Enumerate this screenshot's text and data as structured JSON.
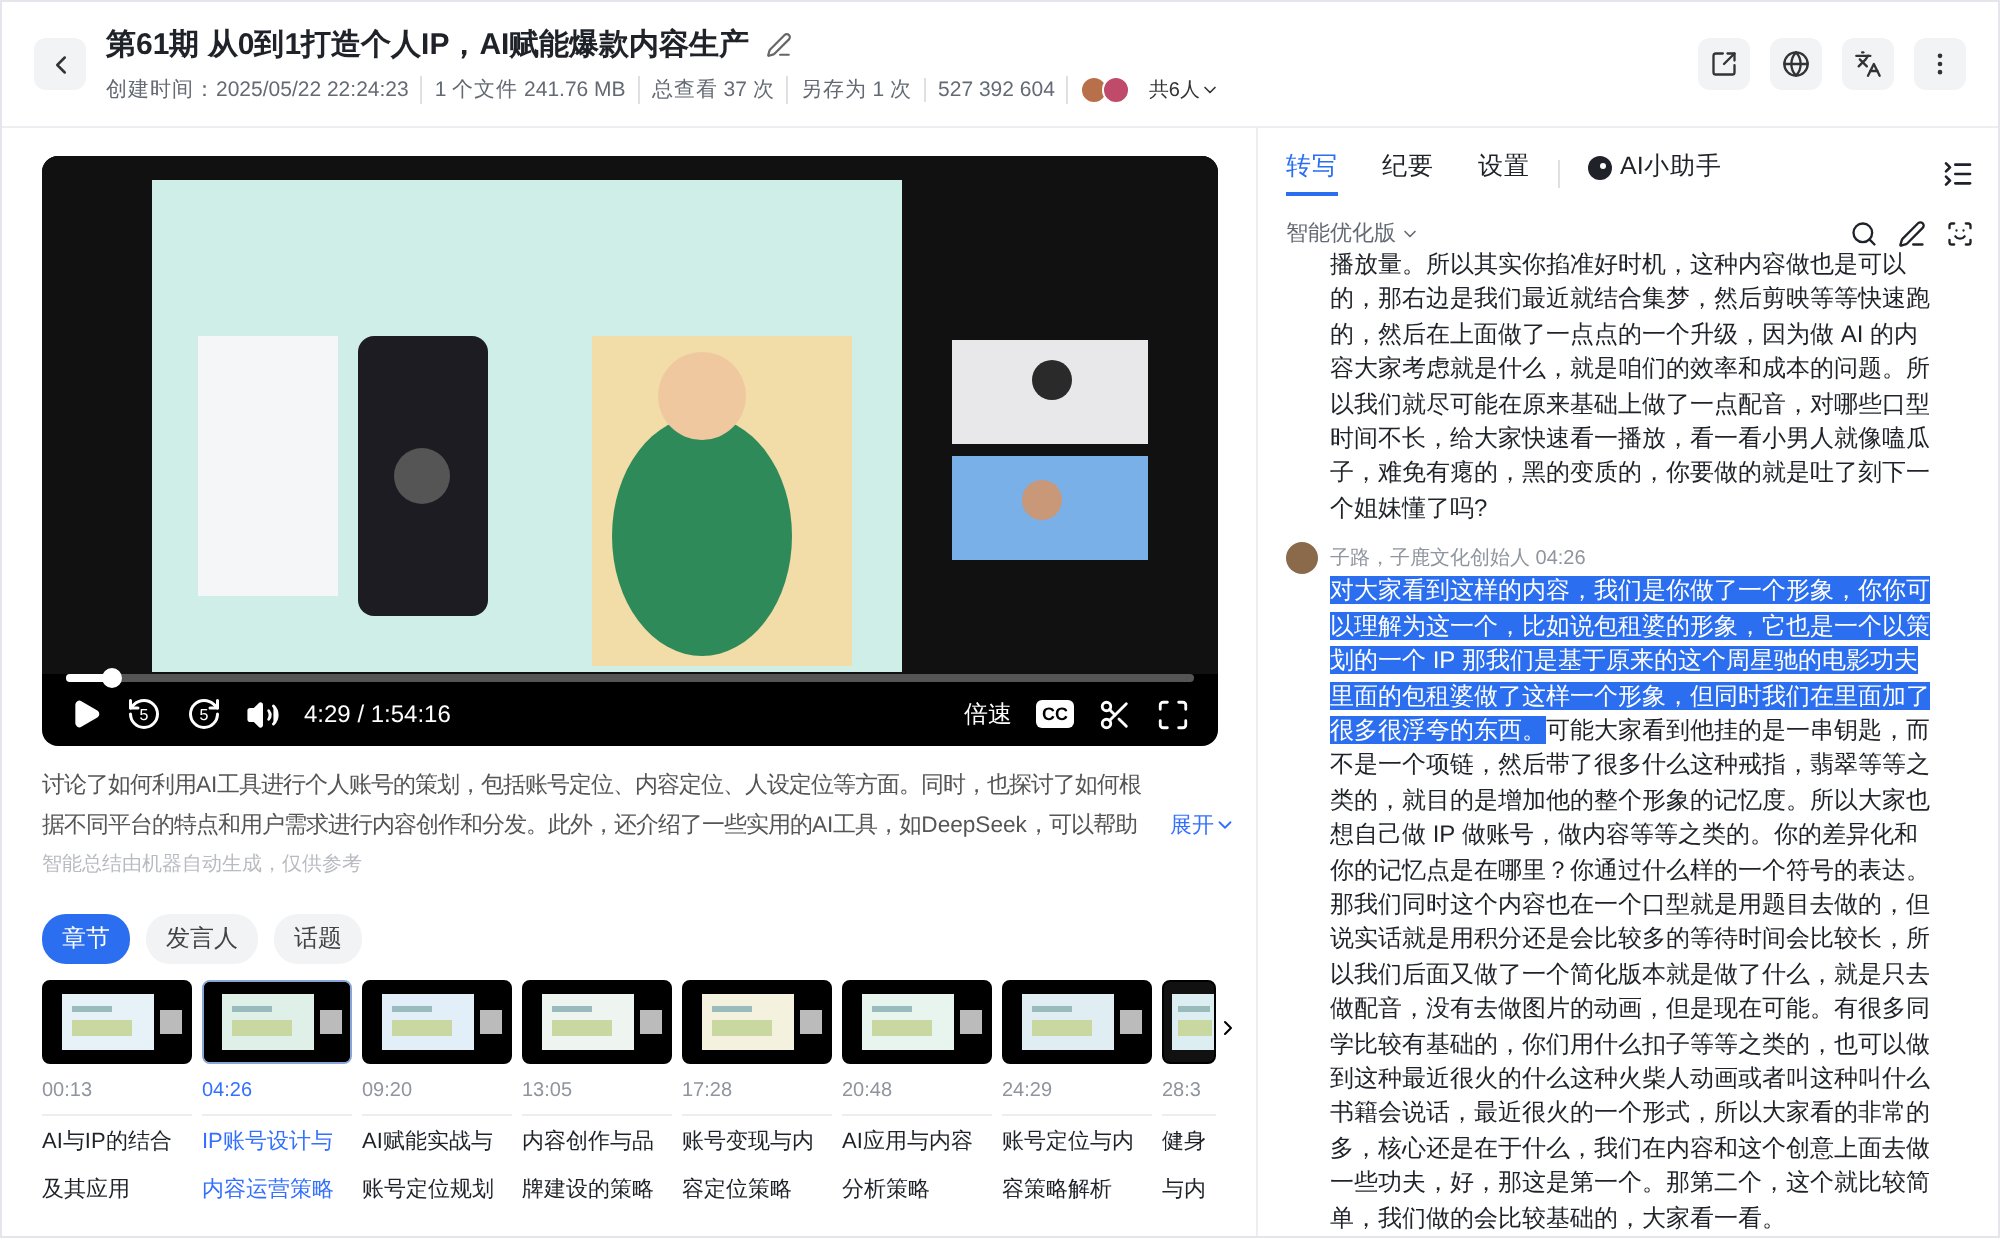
{
  "header": {
    "title": "第61期 从0到1打造个人IP，AI赋能爆款内容生产",
    "meta": [
      "创建时间：2025/05/22 22:24:23",
      "1 个文件 241.76 MB",
      "总查看 37 次",
      "另存为 1 次",
      "527 392 604"
    ],
    "participants": "共6人"
  },
  "player": {
    "kind": "picture",
    "progress": {
      "level": 0.04
    },
    "time": "4:29 / 1:54:16",
    "speed": "倍速",
    "cc": "CC",
    "skip_back": "5",
    "skip_forward": "5"
  },
  "summary": {
    "text": "讨论了如何利用AI工具进行个人账号的策划，包括账号定位、内容定位、人设定位等方面。同时，也探讨了如何根据不同平台的特点和用户需求进行内容创作和分发。此外，还介绍了一些实用的AI工具，如DeepSeek，可以帮助",
    "expand": "展开",
    "note": "智能总结由机器自动生成，仅供参考"
  },
  "chapter_tabs": [
    {
      "label": "章节",
      "selected": true
    },
    {
      "label": "发言人",
      "selected": false
    },
    {
      "label": "话题",
      "selected": false
    }
  ],
  "chapters": [
    {
      "time": "00:13",
      "title_lines": [
        "AI与IP的结合",
        "及其应用"
      ],
      "selected": false
    },
    {
      "time": "04:26",
      "title_lines": [
        "IP账号设计与",
        "内容运营策略"
      ],
      "selected": true
    },
    {
      "time": "09:20",
      "title_lines": [
        "AI赋能实战与",
        "账号定位规划"
      ],
      "selected": false
    },
    {
      "time": "13:05",
      "title_lines": [
        "内容创作与品",
        "牌建设的策略"
      ],
      "selected": false
    },
    {
      "time": "17:28",
      "title_lines": [
        "账号变现与内",
        "容定位策略"
      ],
      "selected": false
    },
    {
      "time": "20:48",
      "title_lines": [
        "AI应用与内容",
        "分析策略"
      ],
      "selected": false
    },
    {
      "time": "24:29",
      "title_lines": [
        "账号定位与内",
        "容策略解析"
      ],
      "selected": false
    },
    {
      "time": "28:3",
      "title_lines": [
        "健身",
        "与内"
      ],
      "selected": false
    }
  ],
  "panel_tabs": [
    {
      "label": "转写",
      "selected": true
    },
    {
      "label": "纪要",
      "selected": false
    },
    {
      "label": "设置",
      "selected": false
    },
    {
      "label": "AI小助手",
      "selected": false
    }
  ],
  "version": "智能优化版",
  "transcript": [
    {
      "text": "播放量。所以其实你掐准好时机，这种内容做也是可以的，那右边是我们最近就结合集梦，然后剪映等等快速跑的，然后在上面做了一点点的一个升级，因为做 AI 的内容大家考虑就是什么，就是咱们的效率和成本的问题。所以我们就尽可能在原来基础上做了一点配音，对哪些口型时间不长，给大家快速看一播放，看一看小男人就像嗑瓜子，难免有瘪的，黑的变质的，你要做的就是吐了刻下一个姐妹懂了吗?"
    },
    {
      "speaker": "子路，子鹿文化创始人",
      "time": "04:26",
      "highlight": "对大家看到这样的内容，我们是你做了一个形象，你你可以理解为这一个，比如说包租婆的形象，它也是一个以策划的一个 IP 那我们是基于原来的这个周星驰的电影功夫里面的包租婆做了这样一个形象，但同时我们在里面加了很多很浮夸的东西。",
      "text": "可能大家看到他挂的是一串钥匙，而不是一个项链，然后带了很多什么这种戒指，翡翠等等之类的，就目的是增加他的整个形象的记忆度。所以大家也想自己做 IP 做账号，做内容等等之类的。你的差异化和你的记忆点是在哪里？你通过什么样的一个符号的表达。那我们同时这个内容也在一个口型就是用题目去做的，但说实话就是用积分还是会比较多的等待时间会比较长，所以我们后面又做了一个简化版本就是做了什么，就是只去做配音，没有去做图片的动画，但是现在可能。有很多同学比较有基础的，你们用什么扣子等等之类的，也可以做到这种最近很火的什么这种火柴人动画或者叫这种叫什么书籍会说话，最近很火的一个形式，所以大家看的非常的多，核心还是在于什么，我们在内容和这个创意上面去做一些功夫，好，那这是第一个。那第二个，这个就比较简单，我们做的会比较基础的，大家看一看。"
    }
  ]
}
